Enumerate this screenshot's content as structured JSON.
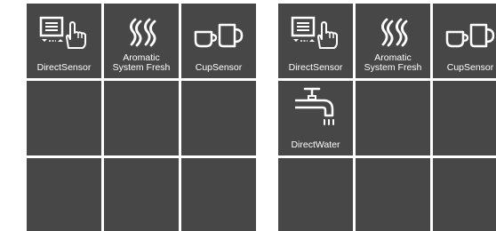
{
  "panels": [
    {
      "tiles": [
        {
          "label": "DirectSensor",
          "icon": "direct-sensor-icon"
        },
        {
          "label": "Aromatic\nSystem Fresh",
          "icon": "aromatic-system-fresh-icon"
        },
        {
          "label": "CupSensor",
          "icon": "cup-sensor-icon"
        },
        {
          "label": "",
          "icon": ""
        },
        {
          "label": "",
          "icon": ""
        },
        {
          "label": "",
          "icon": ""
        },
        {
          "label": "",
          "icon": ""
        },
        {
          "label": "",
          "icon": ""
        },
        {
          "label": "",
          "icon": ""
        }
      ]
    },
    {
      "tiles": [
        {
          "label": "DirectSensor",
          "icon": "direct-sensor-icon"
        },
        {
          "label": "Aromatic\nSystem Fresh",
          "icon": "aromatic-system-fresh-icon"
        },
        {
          "label": "CupSensor",
          "icon": "cup-sensor-icon"
        },
        {
          "label": "DirectWater",
          "icon": "direct-water-icon"
        },
        {
          "label": "",
          "icon": ""
        },
        {
          "label": "",
          "icon": ""
        },
        {
          "label": "",
          "icon": ""
        },
        {
          "label": "",
          "icon": ""
        },
        {
          "label": "",
          "icon": ""
        }
      ]
    }
  ],
  "colors": {
    "tile": "#474747",
    "text": "#ffffff",
    "background": "#ffffff"
  }
}
